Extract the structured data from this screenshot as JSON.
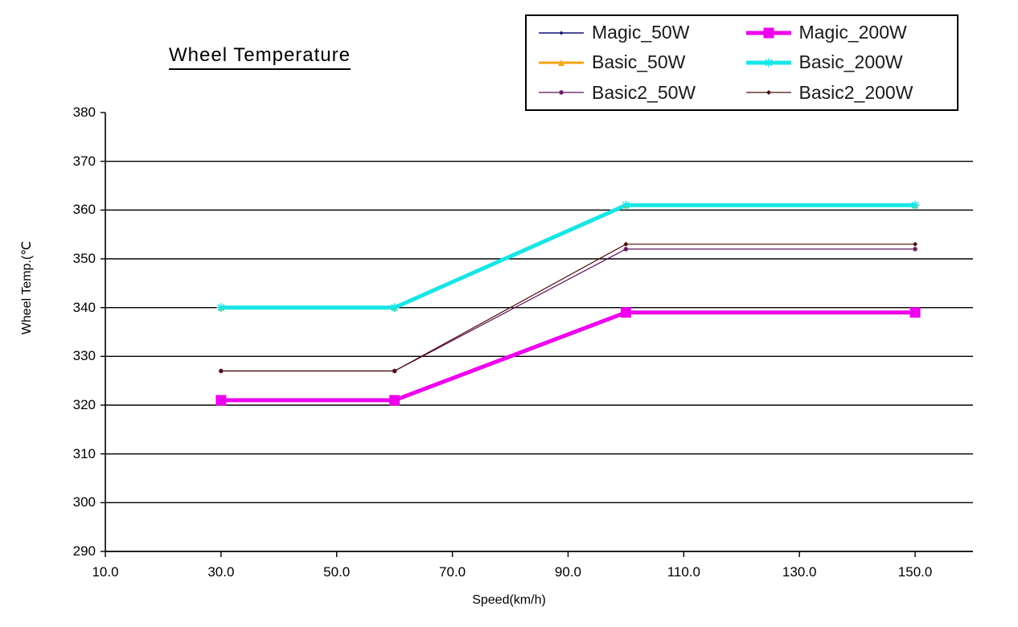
{
  "chart_data": {
    "type": "line",
    "title": "Wheel Temperature",
    "xlabel": "Speed(km/h)",
    "ylabel": "Wheel Temp.(℃",
    "x": [
      30,
      60,
      100,
      150
    ],
    "xlim": [
      10,
      160
    ],
    "ylim": [
      290,
      380
    ],
    "xticks": [
      "10.0",
      "30.0",
      "50.0",
      "70.0",
      "90.0",
      "110.0",
      "130.0",
      "150.0"
    ],
    "xtick_values": [
      10,
      30,
      50,
      70,
      90,
      110,
      130,
      150
    ],
    "yticks": [
      "380",
      "370",
      "360",
      "350",
      "340",
      "330",
      "320",
      "310",
      "300",
      "290"
    ],
    "ytick_values": [
      380,
      370,
      360,
      350,
      340,
      330,
      320,
      310,
      300,
      290
    ],
    "grid": "horizontal",
    "legend_position": "top-right",
    "series": [
      {
        "name": "Magic_50W",
        "color": "#11107a",
        "marker": "diamond",
        "marker_size": 5,
        "line_width": 1.4,
        "values": [
          321,
          321,
          339,
          339
        ]
      },
      {
        "name": "Magic_200W",
        "color": "#ee00ee",
        "marker": "square",
        "marker_size": 13,
        "line_width": 5,
        "values": [
          321,
          321,
          339,
          339
        ]
      },
      {
        "name": "Basic_50W",
        "color": "#f5a516",
        "marker": "triangle",
        "marker_size": 8,
        "line_width": 3,
        "values": [
          340,
          340,
          361,
          361
        ]
      },
      {
        "name": "Basic_200W",
        "color": "#19e5e5",
        "marker": "star",
        "marker_size": 11,
        "line_width": 5,
        "values": [
          340,
          340,
          361,
          361
        ]
      },
      {
        "name": "Basic2_50W",
        "color": "#5c1054",
        "marker": "star",
        "marker_size": 6,
        "line_width": 1.2,
        "values": [
          327,
          327,
          352,
          352
        ]
      },
      {
        "name": "Basic2_200W",
        "color": "#4a0d0d",
        "marker": "diamond",
        "marker_size": 6,
        "line_width": 1.2,
        "values": [
          327,
          327,
          353,
          353
        ]
      }
    ]
  },
  "legend": {
    "items": [
      {
        "label": "Magic_50W"
      },
      {
        "label": "Magic_200W"
      },
      {
        "label": "Basic_50W"
      },
      {
        "label": "Basic_200W"
      },
      {
        "label": "Basic2_50W"
      },
      {
        "label": "Basic2_200W"
      }
    ]
  },
  "colors": {
    "magic_50w": "#11107a",
    "magic_200w": "#ee00ee",
    "basic_50w": "#f5a516",
    "basic_200w": "#19e5e5",
    "basic2_50w": "#5c1054",
    "basic2_200w": "#4a0d0d",
    "axis": "#000000",
    "background": "#ffffff"
  }
}
